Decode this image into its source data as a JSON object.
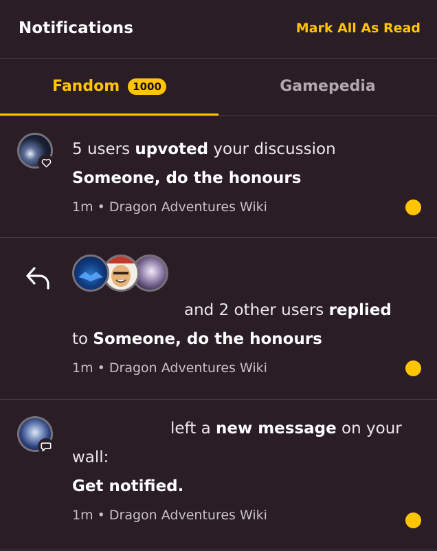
{
  "header": {
    "title": "Notifications",
    "mark_all": "Mark All As Read"
  },
  "tabs": [
    {
      "label": "Fandom",
      "badge": "1000",
      "active": true
    },
    {
      "label": "Gamepedia",
      "active": false
    }
  ],
  "notifications": [
    {
      "prefix": "5 users ",
      "action": "upvoted",
      "suffix": " your discussion",
      "subject": "Someone, do the honours",
      "time": "1m",
      "separator": " • ",
      "wiki": "Dragon Adventures Wiki",
      "badge_icon": "heart-icon",
      "unread": true
    },
    {
      "prefix": "and 2 other users ",
      "action": "replied",
      "mid": "to ",
      "subject": "Someone, do the honours",
      "time": "1m",
      "separator": " • ",
      "wiki": "Dragon Adventures Wiki",
      "icon": "reply-arrow-icon",
      "unread": true
    },
    {
      "prefix": "left a ",
      "action": "new message",
      "suffix": " on your",
      "line2": "wall:",
      "subject": "Get notified.",
      "time": "1m",
      "separator": " • ",
      "wiki": "Dragon Adventures Wiki",
      "badge_icon": "speech-bubble-icon",
      "unread": true
    }
  ],
  "colors": {
    "background": "#2a1d26",
    "accent": "#ffc500",
    "divider": "#4c4049"
  }
}
